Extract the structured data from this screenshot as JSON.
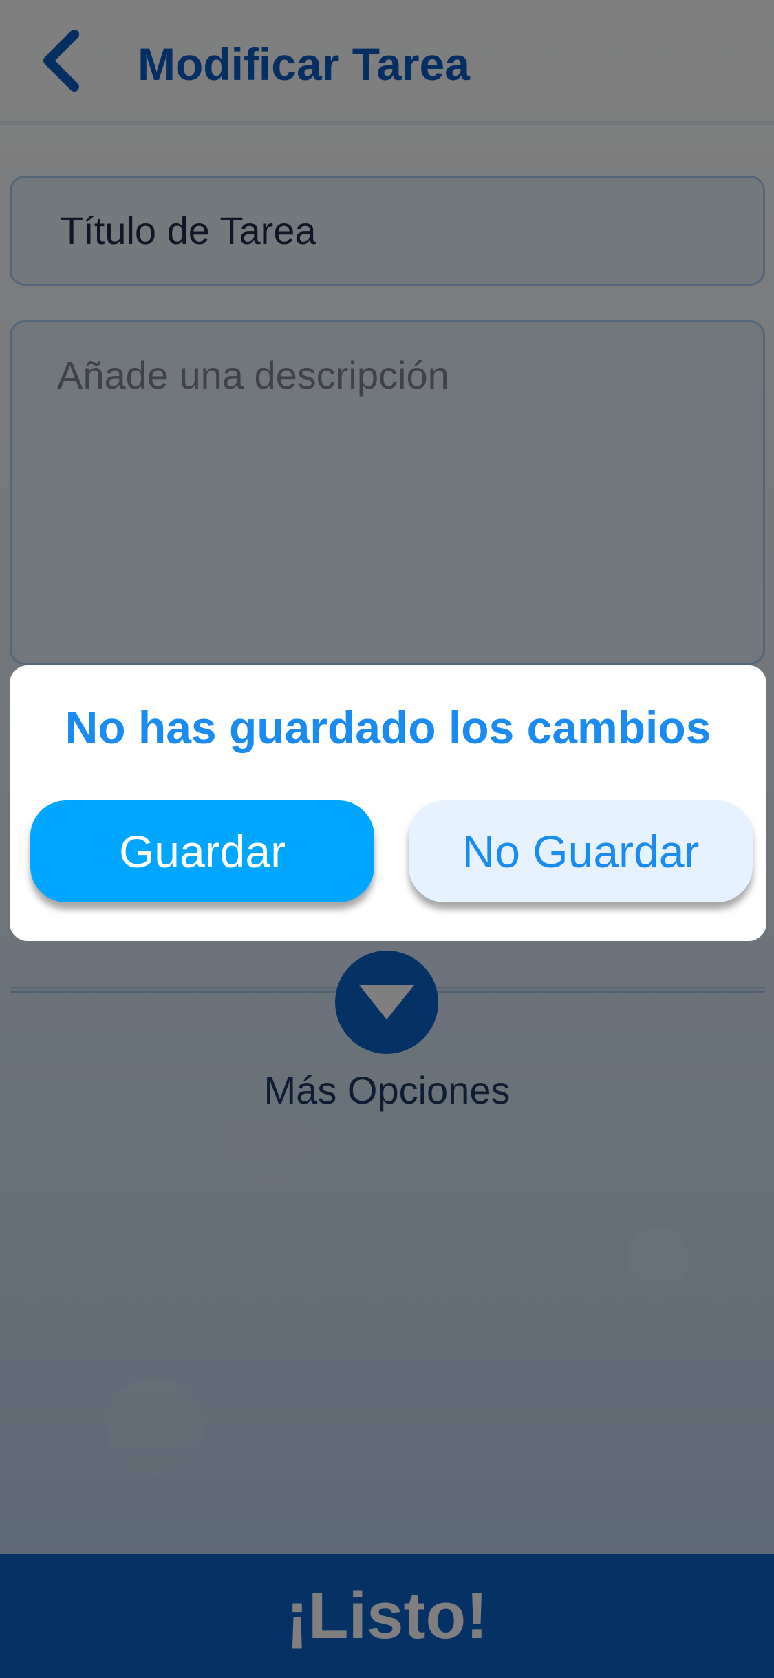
{
  "header": {
    "title": "Modificar Tarea",
    "back_icon": "chevron-left-icon"
  },
  "form": {
    "title_field_value": "Título de Tarea",
    "description_placeholder": "Añade una descripción"
  },
  "more_options": {
    "label": "Más Opciones",
    "icon": "triangle-down-icon"
  },
  "footer": {
    "done_label": "¡Listo!"
  },
  "dialog": {
    "title": "No has guardado los cambios",
    "save_label": "Guardar",
    "dont_save_label": "No Guardar"
  },
  "colors": {
    "primary": "#0a63c9",
    "accent": "#00a6ff",
    "dialog_title": "#1a8bf0",
    "secondary_button_bg": "#e6f2ff"
  }
}
